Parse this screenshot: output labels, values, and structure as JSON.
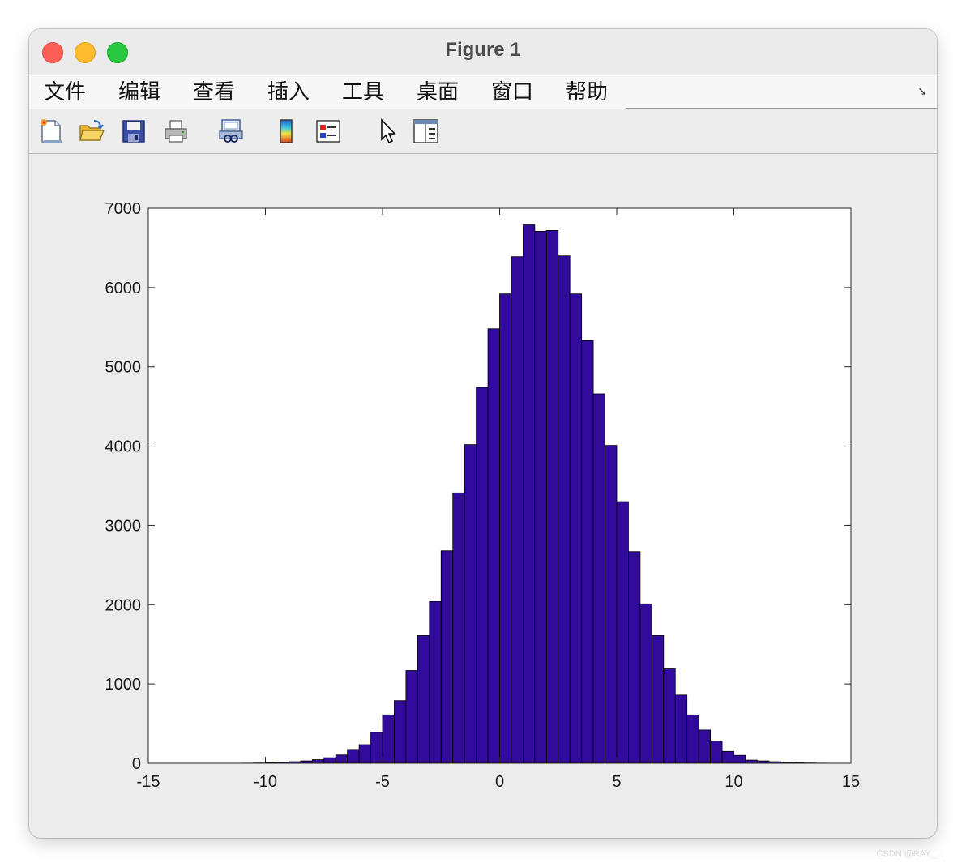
{
  "window": {
    "title": "Figure 1",
    "traffic_lights": {
      "close": "#fe5f57",
      "minimize": "#febc2e",
      "zoom": "#28c840"
    }
  },
  "menubar": {
    "items": [
      {
        "label": "文件"
      },
      {
        "label": "编辑"
      },
      {
        "label": "查看"
      },
      {
        "label": "插入"
      },
      {
        "label": "工具"
      },
      {
        "label": "桌面"
      },
      {
        "label": "窗口"
      },
      {
        "label": "帮助"
      }
    ],
    "dock_arrow": "↘"
  },
  "toolbar": {
    "icons": [
      "new-figure-icon",
      "open-file-icon",
      "save-icon",
      "print-icon",
      "print-preview-icon",
      "colorbar-icon",
      "legend-icon",
      "pointer-icon",
      "property-editor-icon"
    ]
  },
  "chart_data": {
    "type": "bar",
    "title": "",
    "xlabel": "",
    "ylabel": "",
    "xlim": [
      -15,
      15
    ],
    "ylim": [
      0,
      7000
    ],
    "xticks": [
      "-15",
      "-10",
      "-5",
      "0",
      "5",
      "10",
      "15"
    ],
    "yticks": [
      "0",
      "1000",
      "2000",
      "3000",
      "4000",
      "5000",
      "6000",
      "7000"
    ],
    "grid": false,
    "bar_color": "#320b9c",
    "bar_edge_color": "#000000",
    "bin_edges": [
      -11.0,
      -10.5,
      -10.0,
      -9.5,
      -9.0,
      -8.5,
      -8.0,
      -7.5,
      -7.0,
      -6.5,
      -6.0,
      -5.5,
      -5.0,
      -4.5,
      -4.0,
      -3.5,
      -3.0,
      -2.5,
      -2.0,
      -1.5,
      -1.0,
      -0.5,
      0.0,
      0.5,
      1.0,
      1.5,
      2.0,
      2.5,
      3.0,
      3.5,
      4.0,
      4.5,
      5.0,
      5.5,
      6.0,
      6.5,
      7.0,
      7.5,
      8.0,
      8.5,
      9.0,
      9.5,
      10.0,
      10.5,
      11.0,
      11.5,
      12.0,
      12.5,
      13.0,
      13.5,
      14.0,
      14.5
    ],
    "values": [
      2,
      4,
      8,
      12,
      20,
      30,
      45,
      70,
      105,
      175,
      235,
      390,
      610,
      790,
      1170,
      1610,
      2040,
      2680,
      3410,
      4020,
      4740,
      5480,
      5920,
      6390,
      6790,
      6710,
      6720,
      6400,
      5920,
      5330,
      4660,
      4010,
      3300,
      2670,
      2010,
      1610,
      1190,
      860,
      610,
      420,
      280,
      150,
      100,
      40,
      30,
      20,
      10,
      6,
      4,
      2,
      1
    ]
  },
  "watermark": "CSDN @RAY_..."
}
